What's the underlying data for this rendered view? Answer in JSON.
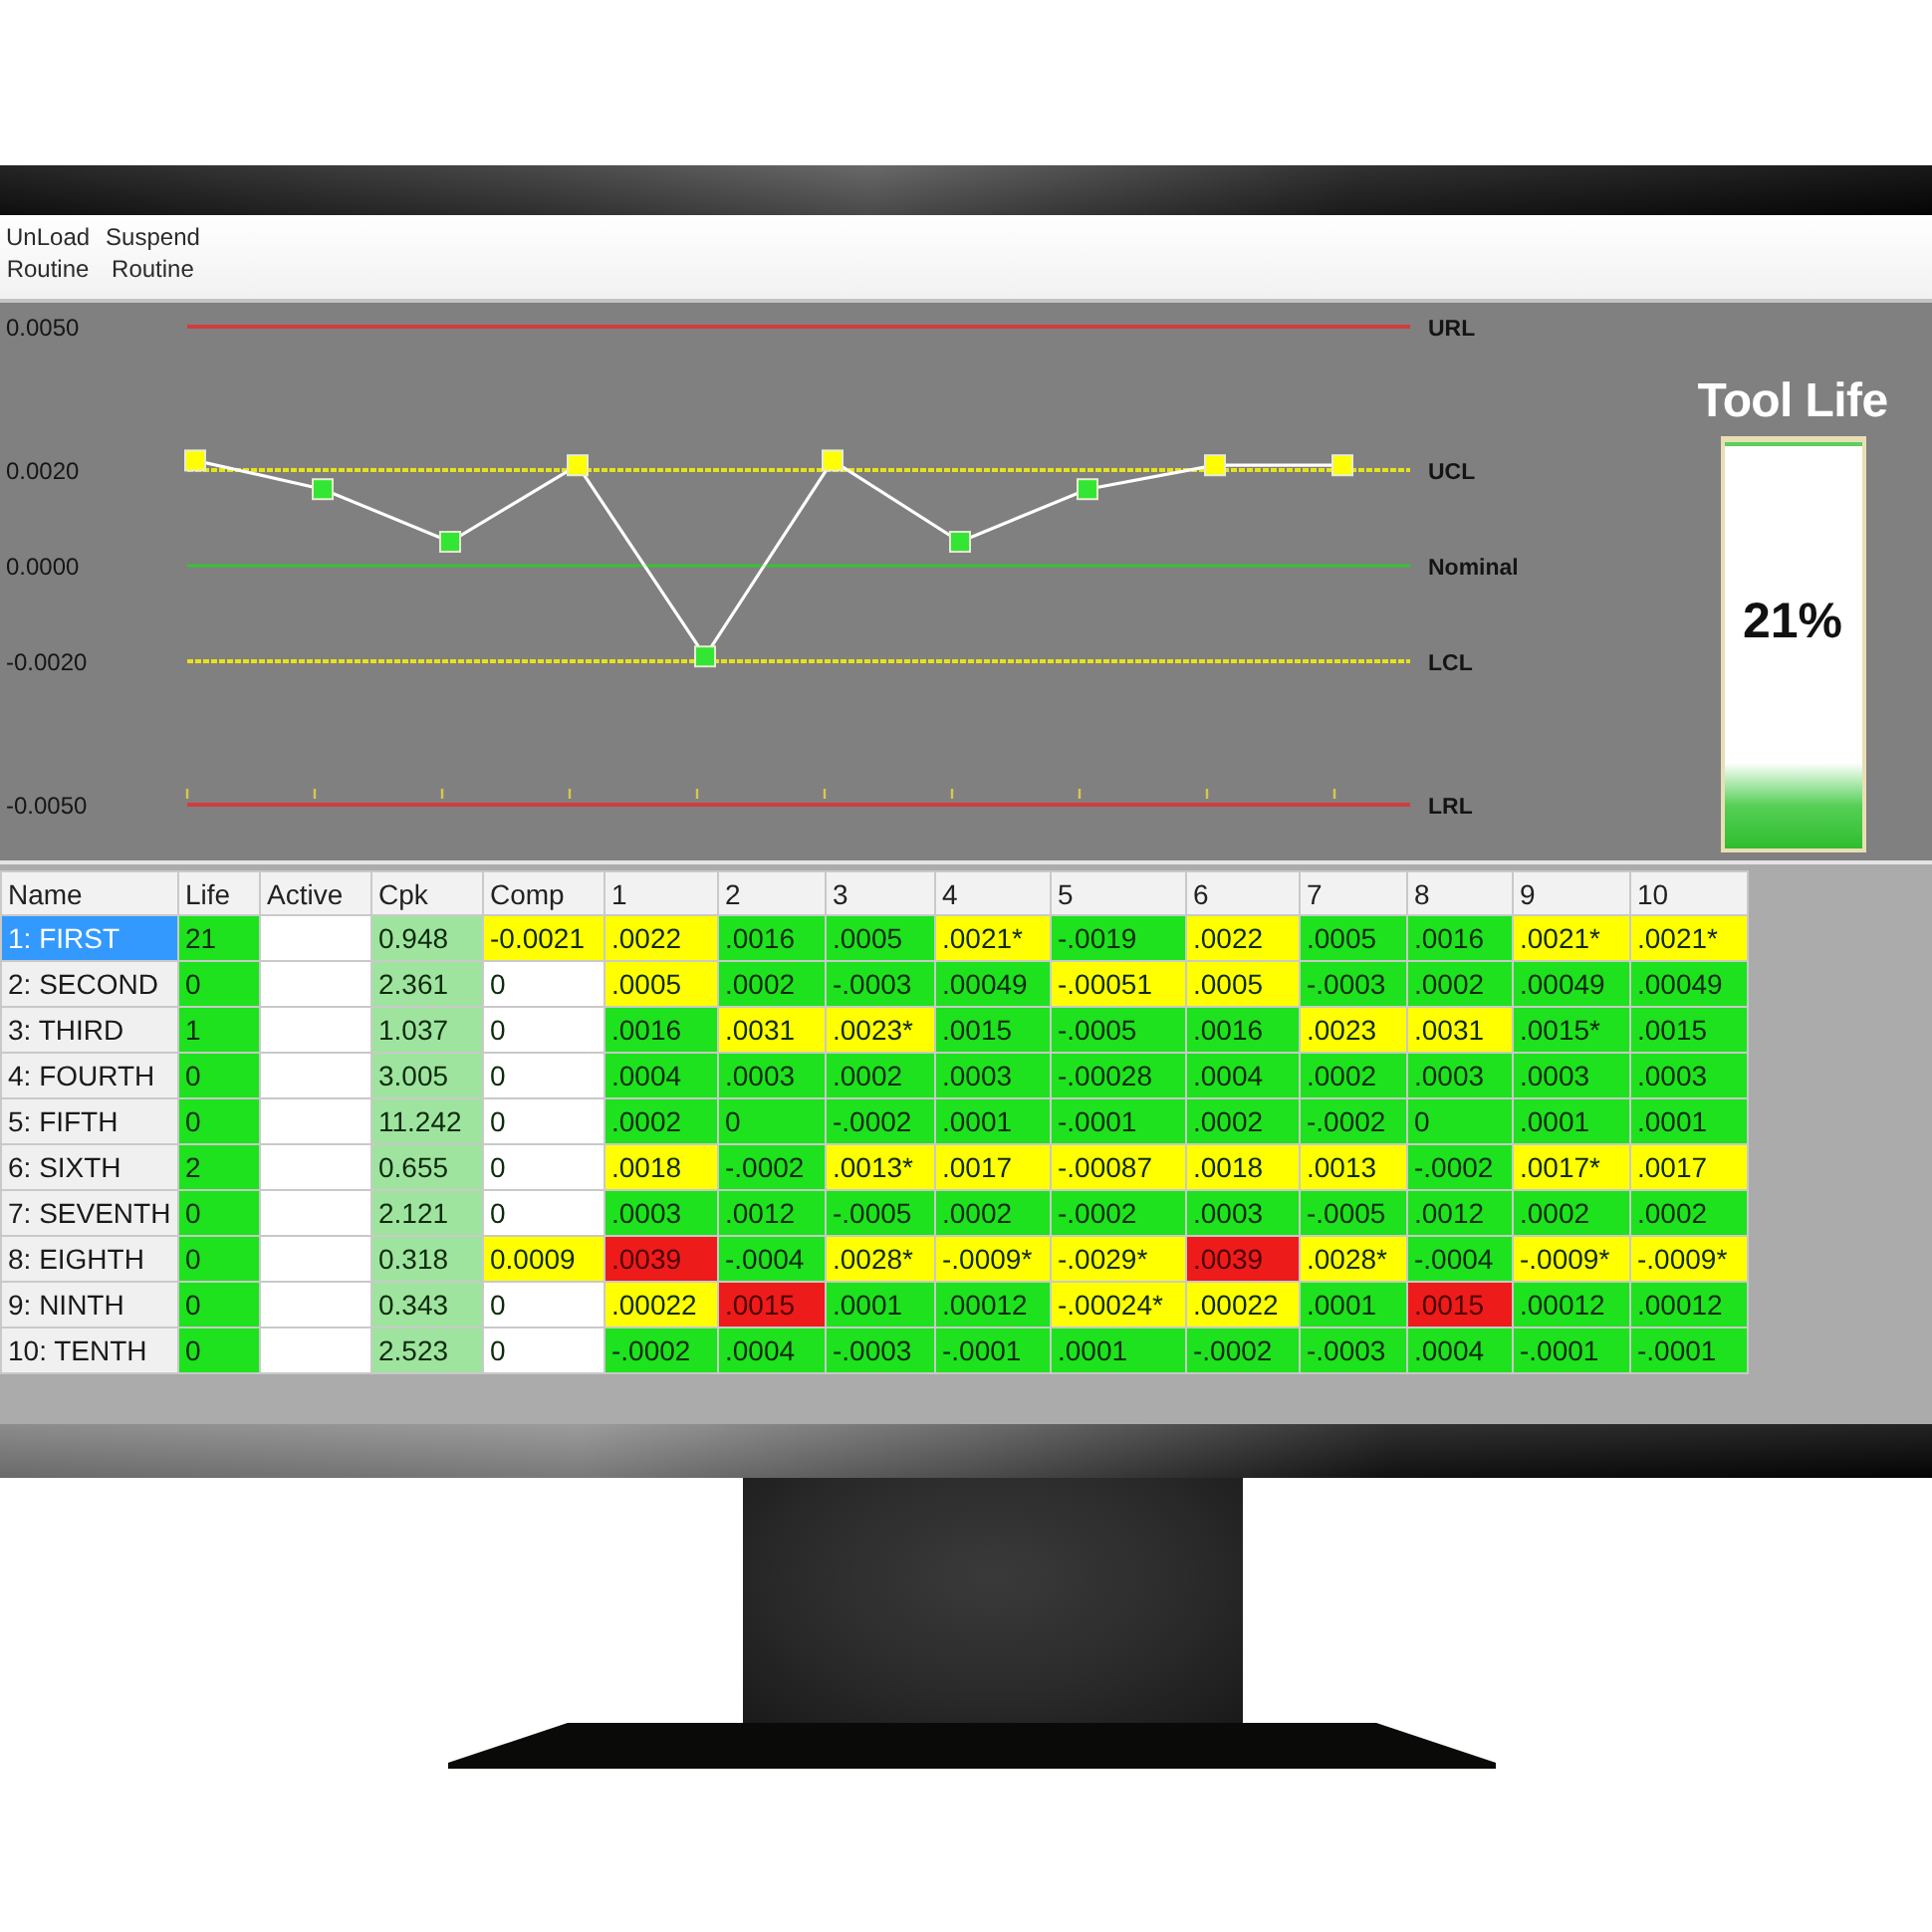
{
  "toolbar": {
    "buttons": [
      "UnLoad Routine",
      "Suspend Routine"
    ]
  },
  "chart": {
    "chart_data": {
      "type": "line",
      "series": [
        {
          "color": "#ffffff",
          "marker": "square",
          "values": [
            0.0022,
            0.0016,
            0.0005,
            0.0021,
            -0.0019,
            0.0022,
            0.0005,
            0.0016,
            0.0021,
            0.0021
          ]
        }
      ],
      "ylim": [
        -0.005,
        0.005
      ],
      "yticks": [
        {
          "value": 0.005,
          "label": "0.0050"
        },
        {
          "value": 0.002,
          "label": "0.0020"
        },
        {
          "value": 0,
          "label": "0.0000"
        },
        {
          "value": -0.002,
          "label": "-0.0020"
        },
        {
          "value": -0.005,
          "label": "-0.0050"
        }
      ],
      "ref_lines": [
        {
          "axis": "y",
          "value": 0.005,
          "label": "URL",
          "color": "#d23c3c"
        },
        {
          "axis": "y",
          "value": 0.002,
          "label": "UCL",
          "color": "#e7e21a"
        },
        {
          "axis": "y",
          "value": 0,
          "label": "Nominal",
          "color": "#37c337"
        },
        {
          "axis": "y",
          "value": -0.002,
          "label": "LCL",
          "color": "#e7e21a"
        },
        {
          "axis": "y",
          "value": -0.005,
          "label": "LRL",
          "color": "#d23c3c"
        }
      ]
    }
  },
  "tool_life": {
    "title": "Tool Life",
    "reading": "21%",
    "level": 0.21
  },
  "table": {
    "columns": [
      "Name",
      "Life",
      "Active",
      "Cpk",
      "Comp",
      "1",
      "2",
      "3",
      "4",
      "5",
      "6",
      "7",
      "8",
      "9",
      "10"
    ],
    "rows": [
      {
        "name": "1: FIRST",
        "selected": true,
        "life": "21",
        "cpk": "0.948",
        "comp": {
          "text": "-0.0021",
          "color": "#ffff00"
        },
        "values": [
          {
            "text": ".0022",
            "color": "#ffff00"
          },
          {
            "text": ".0016",
            "color": "#1de21d"
          },
          {
            "text": ".0005",
            "color": "#1de21d"
          },
          {
            "text": ".0021*",
            "color": "#ffff00"
          },
          {
            "text": "-.0019",
            "color": "#1de21d"
          },
          {
            "text": ".0022",
            "color": "#ffff00"
          },
          {
            "text": ".0005",
            "color": "#1de21d"
          },
          {
            "text": ".0016",
            "color": "#1de21d"
          },
          {
            "text": ".0021*",
            "color": "#ffff00"
          },
          {
            "text": ".0021*",
            "color": "#ffff00"
          }
        ]
      },
      {
        "name": "2: SECOND",
        "selected": false,
        "life": "0",
        "cpk": "2.361",
        "comp": {
          "text": "0",
          "color": "#ffffff"
        },
        "values": [
          {
            "text": ".0005",
            "color": "#ffff00"
          },
          {
            "text": ".0002",
            "color": "#1de21d"
          },
          {
            "text": "-.0003",
            "color": "#1de21d"
          },
          {
            "text": ".00049",
            "color": "#1de21d"
          },
          {
            "text": "-.00051",
            "color": "#ffff00"
          },
          {
            "text": ".0005",
            "color": "#ffff00"
          },
          {
            "text": "-.0003",
            "color": "#1de21d"
          },
          {
            "text": ".0002",
            "color": "#1de21d"
          },
          {
            "text": ".00049",
            "color": "#1de21d"
          },
          {
            "text": ".00049",
            "color": "#1de21d"
          }
        ]
      },
      {
        "name": "3: THIRD",
        "selected": false,
        "life": "1",
        "cpk": "1.037",
        "comp": {
          "text": "0",
          "color": "#ffffff"
        },
        "values": [
          {
            "text": ".0016",
            "color": "#1de21d"
          },
          {
            "text": ".0031",
            "color": "#ffff00"
          },
          {
            "text": ".0023*",
            "color": "#ffff00"
          },
          {
            "text": ".0015",
            "color": "#1de21d"
          },
          {
            "text": "-.0005",
            "color": "#1de21d"
          },
          {
            "text": ".0016",
            "color": "#1de21d"
          },
          {
            "text": ".0023",
            "color": "#ffff00"
          },
          {
            "text": ".0031",
            "color": "#ffff00"
          },
          {
            "text": ".0015*",
            "color": "#1de21d"
          },
          {
            "text": ".0015",
            "color": "#1de21d"
          }
        ]
      },
      {
        "name": "4: FOURTH",
        "selected": false,
        "life": "0",
        "cpk": "3.005",
        "comp": {
          "text": "0",
          "color": "#ffffff"
        },
        "values": [
          {
            "text": ".0004",
            "color": "#1de21d"
          },
          {
            "text": ".0003",
            "color": "#1de21d"
          },
          {
            "text": ".0002",
            "color": "#1de21d"
          },
          {
            "text": ".0003",
            "color": "#1de21d"
          },
          {
            "text": "-.00028",
            "color": "#1de21d"
          },
          {
            "text": ".0004",
            "color": "#1de21d"
          },
          {
            "text": ".0002",
            "color": "#1de21d"
          },
          {
            "text": ".0003",
            "color": "#1de21d"
          },
          {
            "text": ".0003",
            "color": "#1de21d"
          },
          {
            "text": ".0003",
            "color": "#1de21d"
          }
        ]
      },
      {
        "name": "5: FIFTH",
        "selected": false,
        "life": "0",
        "cpk": "11.242",
        "comp": {
          "text": "0",
          "color": "#ffffff"
        },
        "values": [
          {
            "text": ".0002",
            "color": "#1de21d"
          },
          {
            "text": "0",
            "color": "#1de21d"
          },
          {
            "text": "-.0002",
            "color": "#1de21d"
          },
          {
            "text": ".0001",
            "color": "#1de21d"
          },
          {
            "text": "-.0001",
            "color": "#1de21d"
          },
          {
            "text": ".0002",
            "color": "#1de21d"
          },
          {
            "text": "-.0002",
            "color": "#1de21d"
          },
          {
            "text": "0",
            "color": "#1de21d"
          },
          {
            "text": ".0001",
            "color": "#1de21d"
          },
          {
            "text": ".0001",
            "color": "#1de21d"
          }
        ]
      },
      {
        "name": "6: SIXTH",
        "selected": false,
        "life": "2",
        "cpk": "0.655",
        "comp": {
          "text": "0",
          "color": "#ffffff"
        },
        "values": [
          {
            "text": ".0018",
            "color": "#ffff00"
          },
          {
            "text": "-.0002",
            "color": "#1de21d"
          },
          {
            "text": ".0013*",
            "color": "#ffff00"
          },
          {
            "text": ".0017",
            "color": "#ffff00"
          },
          {
            "text": "-.00087",
            "color": "#ffff00"
          },
          {
            "text": ".0018",
            "color": "#ffff00"
          },
          {
            "text": ".0013",
            "color": "#ffff00"
          },
          {
            "text": "-.0002",
            "color": "#1de21d"
          },
          {
            "text": ".0017*",
            "color": "#ffff00"
          },
          {
            "text": ".0017",
            "color": "#ffff00"
          }
        ]
      },
      {
        "name": "7: SEVENTH",
        "selected": false,
        "life": "0",
        "cpk": "2.121",
        "comp": {
          "text": "0",
          "color": "#ffffff"
        },
        "values": [
          {
            "text": ".0003",
            "color": "#1de21d"
          },
          {
            "text": ".0012",
            "color": "#1de21d"
          },
          {
            "text": "-.0005",
            "color": "#1de21d"
          },
          {
            "text": ".0002",
            "color": "#1de21d"
          },
          {
            "text": "-.0002",
            "color": "#1de21d"
          },
          {
            "text": ".0003",
            "color": "#1de21d"
          },
          {
            "text": "-.0005",
            "color": "#1de21d"
          },
          {
            "text": ".0012",
            "color": "#1de21d"
          },
          {
            "text": ".0002",
            "color": "#1de21d"
          },
          {
            "text": ".0002",
            "color": "#1de21d"
          }
        ]
      },
      {
        "name": "8: EIGHTH",
        "selected": false,
        "life": "0",
        "cpk": "0.318",
        "comp": {
          "text": "0.0009",
          "color": "#ffff00"
        },
        "values": [
          {
            "text": ".0039",
            "color": "#ee1b1b"
          },
          {
            "text": "-.0004",
            "color": "#1de21d"
          },
          {
            "text": ".0028*",
            "color": "#ffff00"
          },
          {
            "text": "-.0009*",
            "color": "#ffff00"
          },
          {
            "text": "-.0029*",
            "color": "#ffff00"
          },
          {
            "text": ".0039",
            "color": "#ee1b1b"
          },
          {
            "text": ".0028*",
            "color": "#ffff00"
          },
          {
            "text": "-.0004",
            "color": "#1de21d"
          },
          {
            "text": "-.0009*",
            "color": "#ffff00"
          },
          {
            "text": "-.0009*",
            "color": "#ffff00"
          }
        ]
      },
      {
        "name": "9: NINTH",
        "selected": false,
        "life": "0",
        "cpk": "0.343",
        "comp": {
          "text": "0",
          "color": "#ffffff"
        },
        "values": [
          {
            "text": ".00022",
            "color": "#ffff00"
          },
          {
            "text": ".0015",
            "color": "#ee1b1b"
          },
          {
            "text": ".0001",
            "color": "#1de21d"
          },
          {
            "text": ".00012",
            "color": "#1de21d"
          },
          {
            "text": "-.00024*",
            "color": "#ffff00"
          },
          {
            "text": ".00022",
            "color": "#ffff00"
          },
          {
            "text": ".0001",
            "color": "#1de21d"
          },
          {
            "text": ".0015",
            "color": "#ee1b1b"
          },
          {
            "text": ".00012",
            "color": "#1de21d"
          },
          {
            "text": ".00012",
            "color": "#1de21d"
          }
        ]
      },
      {
        "name": "10: TENTH",
        "selected": false,
        "life": "0",
        "cpk": "2.523",
        "comp": {
          "text": "0",
          "color": "#ffffff"
        },
        "values": [
          {
            "text": "-.0002",
            "color": "#1de21d"
          },
          {
            "text": ".0004",
            "color": "#1de21d"
          },
          {
            "text": "-.0003",
            "color": "#1de21d"
          },
          {
            "text": "-.0001",
            "color": "#1de21d"
          },
          {
            "text": ".0001",
            "color": "#1de21d"
          },
          {
            "text": "-.0002",
            "color": "#1de21d"
          },
          {
            "text": "-.0003",
            "color": "#1de21d"
          },
          {
            "text": ".0004",
            "color": "#1de21d"
          },
          {
            "text": "-.0001",
            "color": "#1de21d"
          },
          {
            "text": "-.0001",
            "color": "#1de21d"
          }
        ]
      }
    ]
  }
}
